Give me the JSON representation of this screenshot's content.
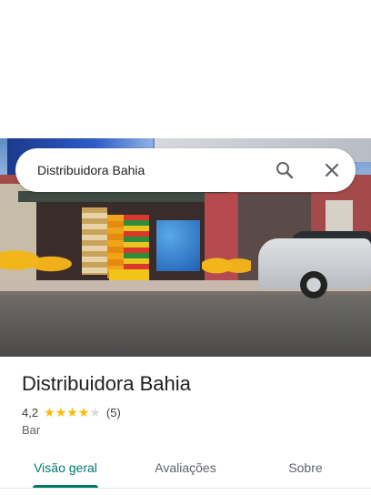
{
  "search": {
    "query": "Distribuidora Bahia"
  },
  "place": {
    "name": "Distribuidora Bahia",
    "rating": "4,2",
    "stars_filled": 4,
    "stars_total": 5,
    "review_count": "(5)",
    "category": "Bar"
  },
  "tabs": [
    {
      "label": "Visão geral",
      "active": true
    },
    {
      "label": "Avaliações",
      "active": false
    },
    {
      "label": "Sobre",
      "active": false
    }
  ],
  "icons": {
    "search": "search-icon",
    "close": "close-icon",
    "star": "star-icon"
  },
  "colors": {
    "accent": "#00796b",
    "star": "#fbbc04",
    "star_off": "#dadce0"
  }
}
